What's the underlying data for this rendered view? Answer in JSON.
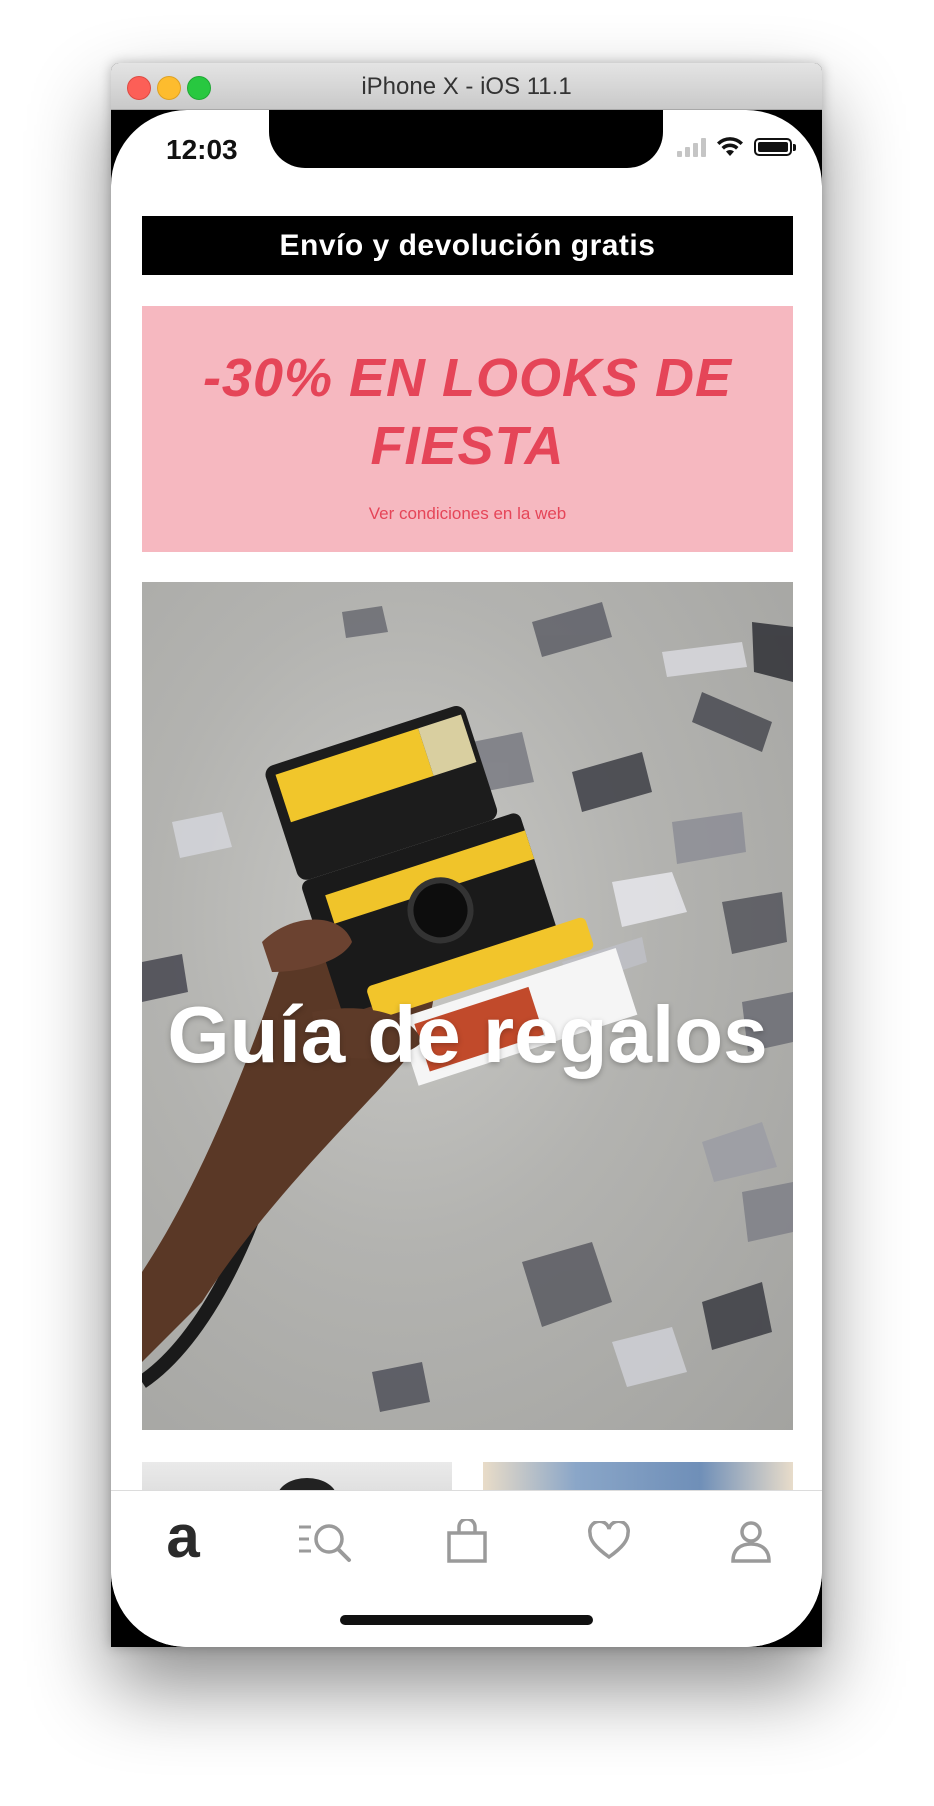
{
  "window": {
    "title": "iPhone X - iOS 11.1"
  },
  "status_bar": {
    "time": "12:03",
    "icons": [
      "cellular-signal-icon",
      "wifi-icon",
      "battery-icon"
    ]
  },
  "promo_bar": {
    "text": "Envío y devolución gratis"
  },
  "sale_banner": {
    "headline": "-30% EN LOOKS DE FIESTA",
    "terms": "Ver condiciones en la web",
    "background": "#f6b8c0",
    "text_color": "#e54558"
  },
  "hero": {
    "title": "Guía de regalos"
  },
  "tab_bar": {
    "items": [
      {
        "name": "home",
        "icon": "asos-logo-icon",
        "glyph": "a"
      },
      {
        "name": "search",
        "icon": "search-icon"
      },
      {
        "name": "bag",
        "icon": "shopping-bag-icon"
      },
      {
        "name": "saved",
        "icon": "heart-icon"
      },
      {
        "name": "account",
        "icon": "user-icon"
      }
    ]
  }
}
